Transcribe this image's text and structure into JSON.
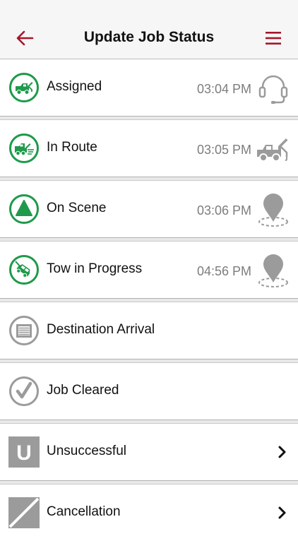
{
  "header": {
    "title": "Update Job Status"
  },
  "colors": {
    "accent": "#a3172a",
    "done_green": "#1e9a4a",
    "pending_gray": "#9b9b9b",
    "time_gray": "#7d7d7d"
  },
  "statuses": [
    {
      "label": "Assigned",
      "time": "03:04 PM",
      "state": "completed",
      "icon": "tow-truck-icon",
      "right_icon": "headset-icon"
    },
    {
      "label": "In Route",
      "time": "03:05 PM",
      "state": "completed",
      "icon": "moving-tow-truck-icon",
      "right_icon": "tow-truck-icon"
    },
    {
      "label": "On Scene",
      "time": "03:06 PM",
      "state": "completed",
      "icon": "warning-triangle-icon",
      "right_icon": "location-pin-icon"
    },
    {
      "label": "Tow in Progress",
      "time": "04:56 PM",
      "state": "completed",
      "icon": "towed-car-icon",
      "right_icon": "location-pin-icon"
    },
    {
      "label": "Destination Arrival",
      "state": "pending",
      "icon": "garage-icon"
    },
    {
      "label": "Job Cleared",
      "state": "pending",
      "icon": "checkmark-icon"
    },
    {
      "label": "Unsuccessful",
      "badge": "U",
      "icon": "unsuccessful-icon"
    },
    {
      "label": "Cancellation",
      "icon": "cancellation-icon"
    }
  ]
}
